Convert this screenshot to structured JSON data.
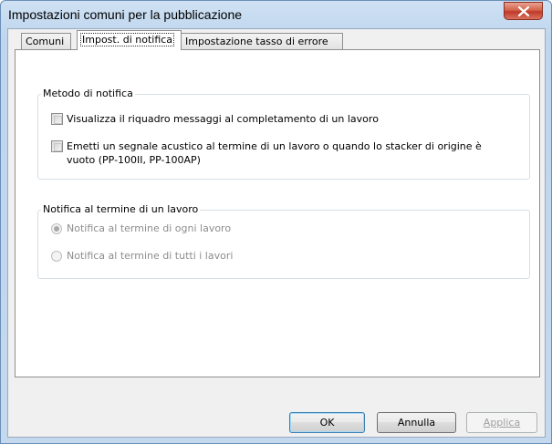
{
  "window": {
    "title": "Impostazioni comuni per la pubblicazione"
  },
  "tabs": [
    {
      "label": "Comuni",
      "active": false
    },
    {
      "label": "Impost. di notifica",
      "active": true
    },
    {
      "label": "Impostazione tasso di errore",
      "active": false
    }
  ],
  "notify_method": {
    "legend": "Metodo di notifica",
    "options": [
      {
        "label": "Visualizza il riquadro messaggi al completamento di un lavoro",
        "checked": false
      },
      {
        "label_line1": "Emetti un segnale acustico al termine di un lavoro o quando lo stacker di origine è",
        "label_line2": "vuoto (PP-100II, PP-100AP)",
        "checked": false
      }
    ]
  },
  "notify_end": {
    "legend": "Notifica al termine di un lavoro",
    "options": [
      {
        "label": "Notifica al termine di ogni lavoro",
        "selected": true,
        "enabled": false
      },
      {
        "label": "Notifica al termine di tutti i lavori",
        "selected": false,
        "enabled": false
      }
    ]
  },
  "buttons": {
    "ok": "OK",
    "cancel": "Annulla",
    "apply": "Applica"
  }
}
